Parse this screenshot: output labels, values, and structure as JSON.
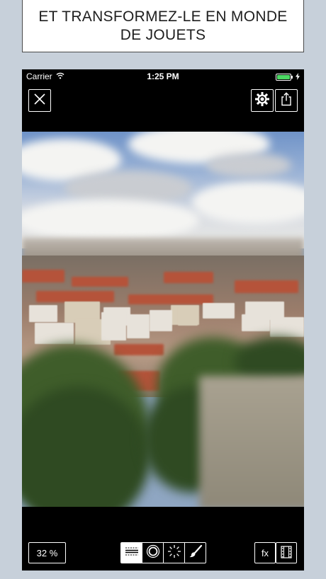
{
  "caption": {
    "line1": "ET TRANSFORMEZ-LE EN MONDE",
    "line2": "DE JOUETS"
  },
  "status_bar": {
    "carrier": "Carrier",
    "time": "1:25 PM",
    "battery_level": 1.0,
    "battery_color": "#4cd964"
  },
  "top_bar": {
    "close_icon": "close-icon",
    "settings_icon": "gear-icon",
    "share_icon": "share-icon"
  },
  "bottom_toolbar": {
    "zoom_label": "32 %",
    "modes": [
      {
        "name": "linear-tilt",
        "icon": "linear-blur-icon",
        "active": true
      },
      {
        "name": "radial-tilt",
        "icon": "radial-blur-icon",
        "active": false
      },
      {
        "name": "brightness",
        "icon": "brightness-icon",
        "active": false
      },
      {
        "name": "brush",
        "icon": "brush-icon",
        "active": false
      }
    ],
    "fx_label": "fx",
    "film_icon": "film-icon"
  },
  "colors": {
    "background": "#c7d0da",
    "app_black": "#000000",
    "caption_text": "#1e1e1e"
  }
}
